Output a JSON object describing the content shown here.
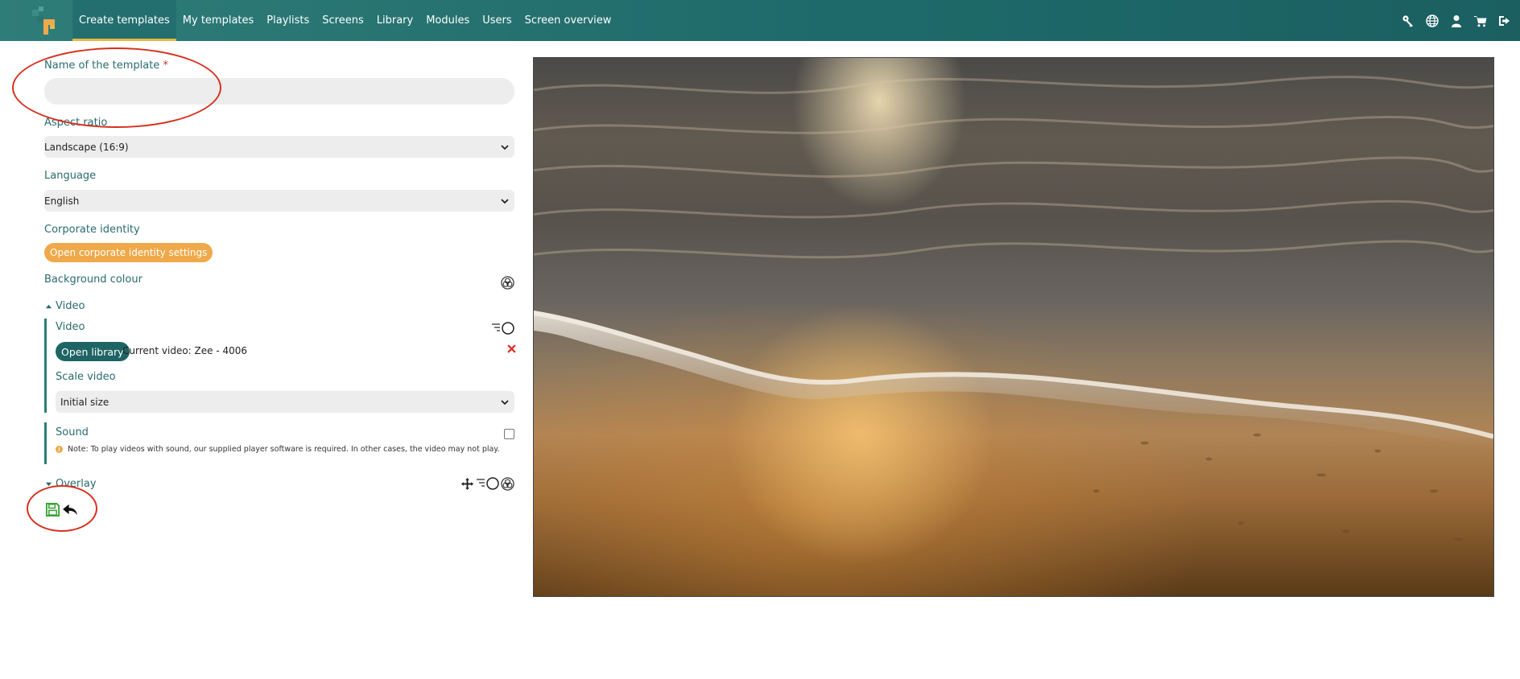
{
  "nav": {
    "items": [
      {
        "label": "Create templates"
      },
      {
        "label": "My templates"
      },
      {
        "label": "Playlists"
      },
      {
        "label": "Screens"
      },
      {
        "label": "Library"
      },
      {
        "label": "Modules"
      },
      {
        "label": "Users"
      },
      {
        "label": "Screen overview"
      }
    ],
    "active_index": 0,
    "icons": [
      "key-icon",
      "globe-icon",
      "user-icon",
      "cart-icon",
      "logout-icon"
    ]
  },
  "form": {
    "template_name": {
      "label": "Name of the template",
      "required_mark": "*",
      "value": ""
    },
    "aspect_ratio": {
      "label": "Aspect ratio",
      "value": "Landscape (16:9)"
    },
    "language": {
      "label": "Language",
      "value": "English"
    },
    "corporate_identity": {
      "label": "Corporate identity",
      "button": "Open corporate identity settings"
    },
    "background_colour": {
      "label": "Background colour"
    },
    "video_section": {
      "title": "Video",
      "video": {
        "label": "Video",
        "button": "Open library",
        "current": "Current video: Zee - 4006"
      },
      "scale": {
        "label": "Scale video",
        "value": "Initial size"
      },
      "sound": {
        "label": "Sound",
        "checked": false,
        "note": "Note: To play videos with sound, our supplied player software is required.  In other cases, the video may not play."
      }
    },
    "overlay_section": {
      "title": "Overlay"
    }
  },
  "colors": {
    "nav_bg": "#1e6a6a",
    "accent_underline": "#e7b743",
    "label": "#2a6b6e",
    "orange_button": "#f0a94a",
    "dark_button": "#1f6464",
    "annotation": "#d7301f",
    "save_icon": "#3aa337"
  }
}
